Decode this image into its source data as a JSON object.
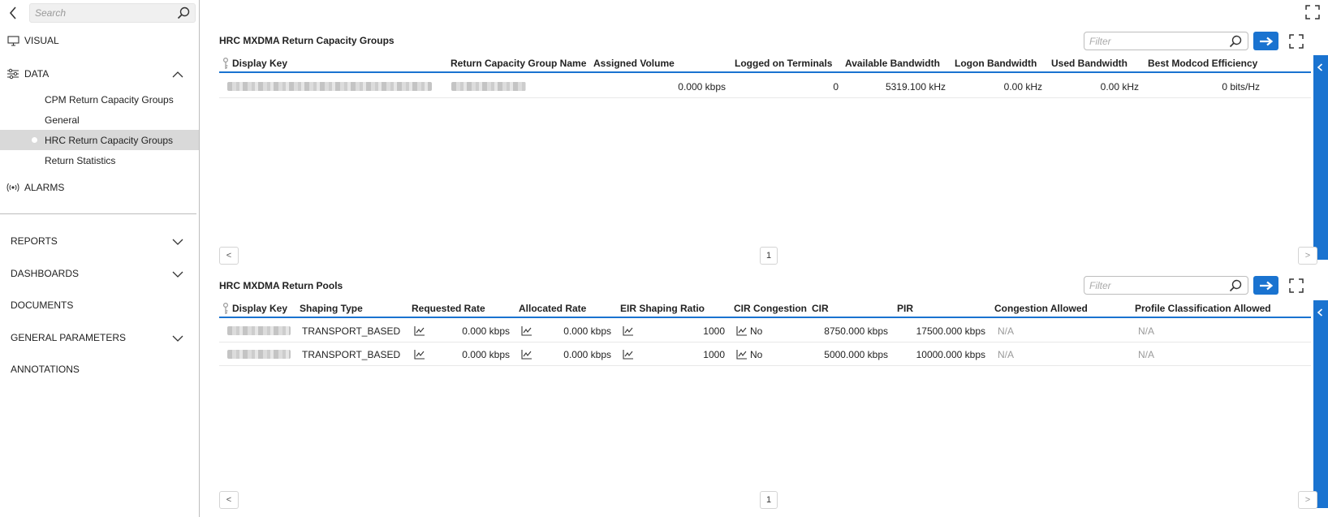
{
  "sidebar": {
    "search_placeholder": "Search",
    "visual_label": "VISUAL",
    "data_label": "DATA",
    "data_items": [
      {
        "label": "CPM Return Capacity Groups"
      },
      {
        "label": "General"
      },
      {
        "label": "HRC Return Capacity Groups"
      },
      {
        "label": "Return Statistics"
      }
    ],
    "active_item": "HRC Return Capacity Groups",
    "alarms_label": "ALARMS",
    "bottom_items": [
      {
        "label": "REPORTS"
      },
      {
        "label": "DASHBOARDS"
      },
      {
        "label": "DOCUMENTS"
      },
      {
        "label": "GENERAL PARAMETERS"
      },
      {
        "label": "ANNOTATIONS"
      }
    ]
  },
  "panel1": {
    "title": "HRC MXDMA Return Capacity Groups",
    "filter_placeholder": "Filter",
    "columns": [
      "Display Key",
      "Return Capacity Group Name",
      "Assigned Volume",
      "Logged on Terminals",
      "Available Bandwidth",
      "Logon Bandwidth",
      "Used Bandwidth",
      "Best Modcod Efficiency"
    ],
    "rows": [
      {
        "assigned_volume": "0.000 kbps",
        "logged_on_terminals": "0",
        "available_bandwidth": "5319.100 kHz",
        "logon_bandwidth": "0.00 kHz",
        "used_bandwidth": "0.00 kHz",
        "best_modcod_efficiency": "0 bits/Hz"
      }
    ],
    "page_prev": "<",
    "page_number": "1",
    "page_next": ">"
  },
  "panel2": {
    "title": "HRC MXDMA Return Pools",
    "filter_placeholder": "Filter",
    "columns": [
      "Display Key",
      "Shaping Type",
      "Requested Rate",
      "Allocated Rate",
      "EIR Shaping Ratio",
      "CIR Congestion",
      "CIR",
      "PIR",
      "Congestion Allowed",
      "Profile Classification Allowed"
    ],
    "rows": [
      {
        "shaping_type": "TRANSPORT_BASED",
        "requested_rate": "0.000 kbps",
        "allocated_rate": "0.000 kbps",
        "eir_shaping_ratio": "1000",
        "cir_congestion": "No",
        "cir": "8750.000 kbps",
        "pir": "17500.000 kbps",
        "congestion_allowed": "N/A",
        "profile_classification_allowed": "N/A"
      },
      {
        "shaping_type": "TRANSPORT_BASED",
        "requested_rate": "0.000 kbps",
        "allocated_rate": "0.000 kbps",
        "eir_shaping_ratio": "1000",
        "cir_congestion": "No",
        "cir": "5000.000 kbps",
        "pir": "10000.000 kbps",
        "congestion_allowed": "N/A",
        "profile_classification_allowed": "N/A"
      }
    ],
    "page_prev": "<",
    "page_number": "1",
    "page_next": ">"
  },
  "colors": {
    "accent": "#1a73d0",
    "active_item_bg": "#d9d9d9",
    "na_text": "#9a9a9a"
  }
}
